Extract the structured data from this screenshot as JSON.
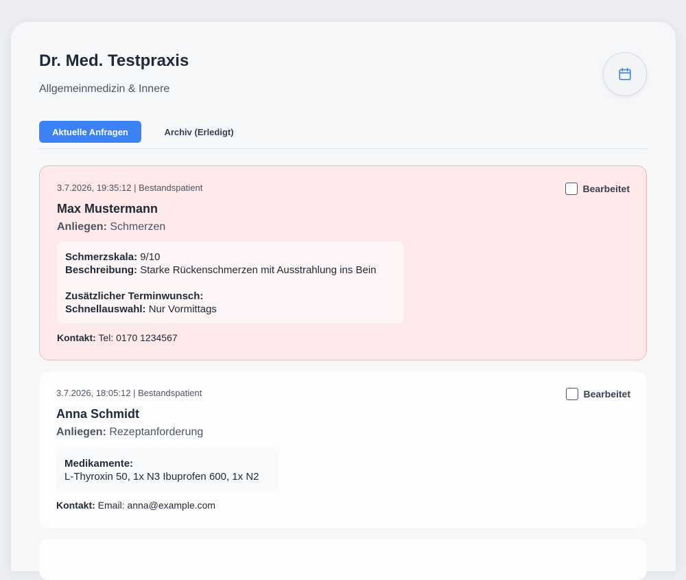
{
  "header": {
    "practice_name": "Dr. Med. Testpraxis",
    "practice_subtitle": "Allgemeinmedizin & Innere",
    "calendar_button_icon": "calendar-icon"
  },
  "tabs": {
    "active": "Aktuelle Anfragen",
    "archive": "Archiv (Erledigt)"
  },
  "colors": {
    "accent": "#3b82f6",
    "urgent_bg": "#fde8ea",
    "urgent_border": "#f3b6bd"
  },
  "requests": [
    {
      "timestamp": "3.7.2026, 19:35:12",
      "separator": "|",
      "patient_type": "Bestandspatient",
      "done_label": "Bearbeitet",
      "done": false,
      "name": "Max Mustermann",
      "concern_label": "Anliegen:",
      "concern": "Schmerzen",
      "pain_scale_label": "Schmerzskala:",
      "pain_scale": "9/10",
      "description_label": "Beschreibung:",
      "description": "Starke Rückenschmerzen mit Ausstrahlung ins Bein",
      "extra_appointment_label": "Zusätzlicher Terminwunsch:",
      "quick_select_label": "Schnellauswahl:",
      "quick_select": "Nur Vormittags",
      "contact_label": "Kontakt:",
      "contact": "Tel: 0170 1234567"
    },
    {
      "timestamp": "3.7.2026, 18:05:12",
      "separator": "|",
      "patient_type": "Bestandspatient",
      "done_label": "Bearbeitet",
      "done": false,
      "name": "Anna Schmidt",
      "concern_label": "Anliegen:",
      "concern": "Rezeptanforderung",
      "medication_label": "Medikamente:",
      "medication": "L-Thyroxin 50, 1x N3 Ibuprofen 600, 1x N2",
      "contact_label": "Kontakt:",
      "contact": "Email: anna@example.com"
    }
  ]
}
